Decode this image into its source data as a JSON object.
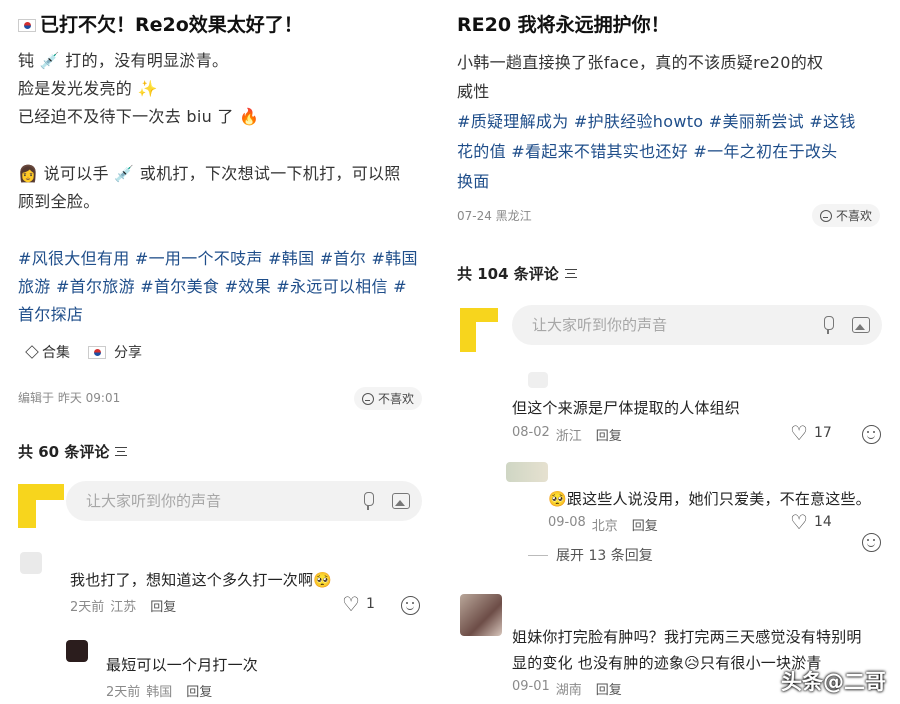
{
  "left": {
    "title": "已打不欠！Re2o效果太好了！",
    "lines": [
      "钝 💉 打的，没有明显淤青。",
      "脸是发光发亮的 ✨",
      "已经迫不及待下一次去 biu 了 🔥"
    ],
    "line4a": "👩 说可以手 💉 或机打，下次想试一下机打，可以照",
    "line4b": "顾到全脸。",
    "tag_lines": [
      "#风很大但有用 #一用一个不吱声 #韩国 #首尔 #韩国",
      "旅游 #首尔旅游 #首尔美食 #效果 #永远可以相信 #",
      "首尔探店"
    ],
    "collection_label": "合集",
    "share_label": "分享",
    "edit_info": "编辑于  昨天 09:01",
    "dislike_label": "不喜欢",
    "comment_count": "共 60 条评论",
    "input_placeholder": "让大家听到你的声音",
    "comments": [
      {
        "text": "我也打了，想知道这个多久打一次啊🥺",
        "time": "2天前",
        "location": "江苏",
        "reply": "回复",
        "likes": "1"
      },
      {
        "text": "最短可以一个月打一次",
        "time": "2天前",
        "location": "韩国",
        "reply": "回复"
      }
    ]
  },
  "right": {
    "title": "RE20 我将永远拥护你！",
    "body_lines": [
      "小韩一趟直接换了张face，真的不该质疑re20的权",
      "威性"
    ],
    "tag_lines": [
      "#质疑理解成为 #护肤经验howto #美丽新尝试 #这钱",
      "花的值 #看起来不错其实也还好 #一年之初在于改头",
      "换面"
    ],
    "date_location": "07-24 黑龙江",
    "dislike_label": "不喜欢",
    "comment_count": "共 104 条评论",
    "input_placeholder": "让大家听到你的声音",
    "comments": [
      {
        "text": "但这个来源是尸体提取的人体组织",
        "time": "08-02",
        "location": "浙江",
        "reply": "回复",
        "likes": "17"
      },
      {
        "text": "🥺跟这些人说没用，她们只爱美，不在意这些。",
        "time": "09-08",
        "location": "北京",
        "reply": "回复",
        "likes": "14"
      },
      {
        "text_a": "姐妹你打完脸有肿吗？我打完两三天感觉没有特别明",
        "text_b": "显的变化  也没有肿的迹象😥只有很小一块淤青",
        "time": "09-01",
        "location": "湖南",
        "reply": "回复"
      }
    ],
    "expand_label": "展开 13 条回复"
  },
  "watermark": "头条@二哥",
  "colors": {
    "tag_blue": "#1f4e8a",
    "avatar_yellow": "#f7d51d",
    "input_bg": "#f2f2f2"
  }
}
